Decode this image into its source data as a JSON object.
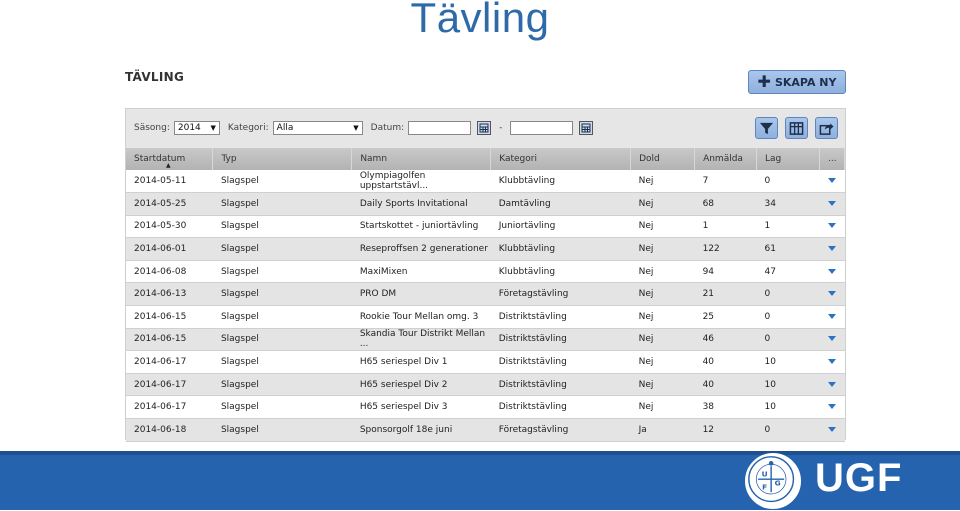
{
  "slide": {
    "title": "Tävling"
  },
  "page": {
    "heading": "TÄVLING",
    "create_label": "SKAPA NY"
  },
  "filters": {
    "season_label": "Säsong:",
    "season_value": "2014",
    "category_label": "Kategori:",
    "category_value": "Alla",
    "date_label": "Datum:",
    "date_separator": "-"
  },
  "toolbar": {
    "icons": [
      "filter-icon",
      "columns-icon",
      "export-icon"
    ]
  },
  "table": {
    "columns": [
      "Startdatum",
      "Typ",
      "Namn",
      "Kategori",
      "Dold",
      "Anmälda",
      "Lag",
      "..."
    ],
    "sorted_column": "Startdatum",
    "rows": [
      [
        "2014-05-11",
        "Slagspel",
        "Olympiagolfen uppstartstävl...",
        "Klubbtävling",
        "Nej",
        "7",
        "0"
      ],
      [
        "2014-05-25",
        "Slagspel",
        "Daily Sports Invitational",
        "Damtävling",
        "Nej",
        "68",
        "34"
      ],
      [
        "2014-05-30",
        "Slagspel",
        "Startskottet - juniortävling",
        "Juniortävling",
        "Nej",
        "1",
        "1"
      ],
      [
        "2014-06-01",
        "Slagspel",
        "Reseproffsen 2 generationer",
        "Klubbtävling",
        "Nej",
        "122",
        "61"
      ],
      [
        "2014-06-08",
        "Slagspel",
        "MaxiMixen",
        "Klubbtävling",
        "Nej",
        "94",
        "47"
      ],
      [
        "2014-06-13",
        "Slagspel",
        "PRO DM",
        "Företagstävling",
        "Nej",
        "21",
        "0"
      ],
      [
        "2014-06-15",
        "Slagspel",
        "Rookie Tour Mellan omg. 3",
        "Distriktstävling",
        "Nej",
        "25",
        "0"
      ],
      [
        "2014-06-15",
        "Slagspel",
        "Skandia Tour Distrikt Mellan ...",
        "Distriktstävling",
        "Nej",
        "46",
        "0"
      ],
      [
        "2014-06-17",
        "Slagspel",
        "H65 seriespel Div 1",
        "Distriktstävling",
        "Nej",
        "40",
        "10"
      ],
      [
        "2014-06-17",
        "Slagspel",
        "H65 seriespel Div 2",
        "Distriktstävling",
        "Nej",
        "40",
        "10"
      ],
      [
        "2014-06-17",
        "Slagspel",
        "H65 seriespel Div 3",
        "Distriktstävling",
        "Nej",
        "38",
        "10"
      ],
      [
        "2014-06-18",
        "Slagspel",
        "Sponsorgolf 18e juni",
        "Företagstävling",
        "Ja",
        "12",
        "0"
      ]
    ]
  },
  "footer": {
    "logo_text": "UGF",
    "emblem_text": "UPPLANDS GOLFFÖRBUND",
    "emblem_letters": [
      "U",
      "G",
      "F"
    ]
  },
  "colors": {
    "accent": "#2e6aa8",
    "footer": "#2563ae",
    "button": "#9dbce6",
    "dropdown_arrow": "#2a73c4"
  }
}
